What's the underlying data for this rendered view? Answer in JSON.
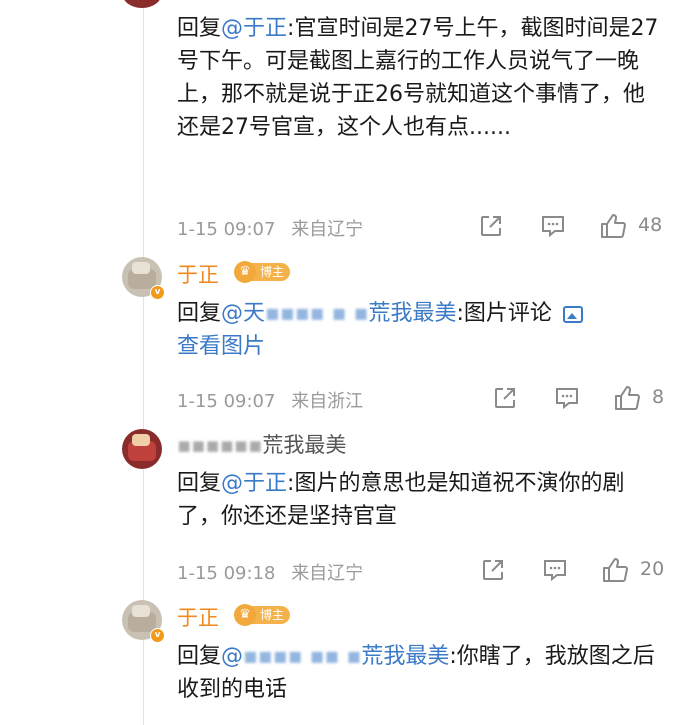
{
  "comments": [
    {
      "reply_prefix": "回复",
      "mention": "@于正",
      "body": ":官宣时间是27号上午，截图时间是27号下午。可是截图上嘉行的工作人员说气了一晚上，那不就是说于正26号就知道这个事情了，他还是27号官宣，这个人也有点......",
      "time": "1-15 09:07",
      "location": "来自辽宁",
      "likes": "48"
    },
    {
      "username": "于正",
      "badge": "博主",
      "reply_prefix": "回复",
      "mention_masked": "@天",
      "mention_tail": "荒我最美",
      "body": ":图片评论",
      "view_image": "查看图片",
      "time": "1-15 09:07",
      "location": "来自浙江",
      "likes": "8"
    },
    {
      "username_tail": "荒我最美",
      "reply_prefix": "回复",
      "mention": "@于正",
      "body": ":图片的意思也是知道祝不演你的剧了，你还还是坚持官宣",
      "time": "1-15 09:18",
      "location": "来自辽宁",
      "likes": "20"
    },
    {
      "username": "于正",
      "badge": "博主",
      "reply_prefix": "回复",
      "mention_masked": "@",
      "mention_tail": "荒我最美",
      "body": ":你瞎了，我放图之后收到的电话"
    }
  ]
}
